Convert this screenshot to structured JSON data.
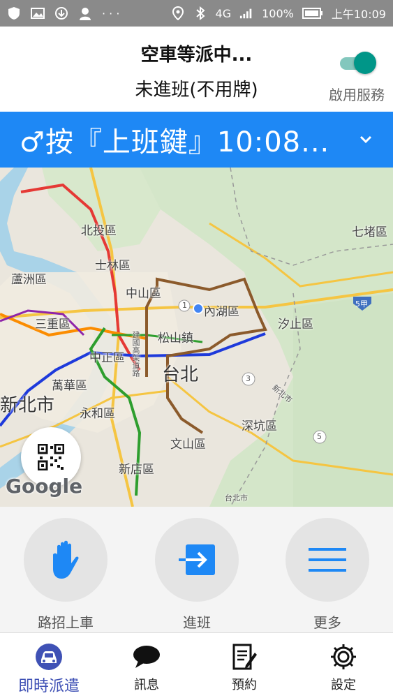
{
  "status_bar": {
    "battery": "100%",
    "time": "上午10:09",
    "network": "4G",
    "icons": [
      "shield-icon",
      "image-icon",
      "download-icon",
      "avatar-icon",
      "more-icon",
      "location-icon",
      "bluetooth-icon",
      "signal-icon",
      "battery-icon"
    ]
  },
  "header": {
    "title": "空車等派中...",
    "subtitle": "未進班(不用牌)",
    "service_toggle_label": "啟用服務",
    "service_enabled": true
  },
  "banner": {
    "text": "♂按『上班鍵』10:08..."
  },
  "map": {
    "labels": {
      "beitou": "北投區",
      "shilin": "士林區",
      "luzhou": "蘆洲區",
      "zhongshan": "中山區",
      "neihu": "內湖區",
      "sanchong": "三重區",
      "songshan": "松山鎮",
      "xizhi": "汐止區",
      "zhongzheng": "中正區",
      "taipei": "台北",
      "wanhua": "萬華區",
      "newtaipei": "新北市",
      "yonghe": "永和區",
      "shenkeng": "深坑區",
      "wenshan": "文山區",
      "xindian": "新店區",
      "qidu": "七堵區",
      "road_5a": "5甲",
      "route_3": "3",
      "route_5": "5",
      "road_1": "1",
      "jianguo": "建國高架道路",
      "xinbei_road": "新北市",
      "taibei_road": "台北市"
    },
    "attribution": "Google"
  },
  "actions": [
    {
      "label": "路招上車",
      "icon": "hand-icon"
    },
    {
      "label": "進班",
      "icon": "login-icon"
    },
    {
      "label": "更多",
      "icon": "menu-icon"
    }
  ],
  "bottom_nav": [
    {
      "label": "即時派遣",
      "icon": "taxi-icon",
      "active": true
    },
    {
      "label": "訊息",
      "icon": "chat-icon",
      "active": false
    },
    {
      "label": "預約",
      "icon": "notepad-icon",
      "active": false
    },
    {
      "label": "設定",
      "icon": "gear-icon",
      "active": false
    }
  ],
  "colors": {
    "accent_blue": "#1e88f5",
    "toggle_teal": "#009688",
    "nav_active": "#3f51b5"
  }
}
